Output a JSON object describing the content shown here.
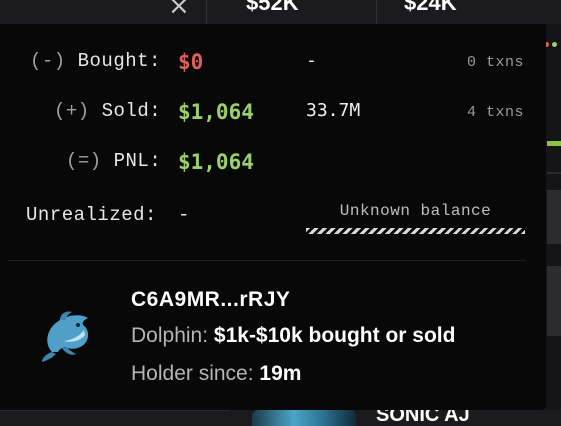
{
  "background": {
    "close_icon": "×",
    "stat_1": "$52K",
    "stat_2": "$24K",
    "token_name": "SONIC AJ",
    "dot_colors": [
      "#e0615c",
      "#9bd06a"
    ],
    "accent_green": "#8ec13f"
  },
  "tooltip": {
    "bought": {
      "symbol": "(-)",
      "label": "Bought:",
      "amount": "$0",
      "quantity": "-",
      "txns": "0 txns"
    },
    "sold": {
      "symbol": "(+)",
      "label": "Sold:",
      "amount": "$1,064",
      "quantity": "33.7M",
      "txns": "4 txns"
    },
    "pnl": {
      "symbol": "(=)",
      "label": "PNL:",
      "amount": "$1,064"
    },
    "unrealized": {
      "label": "Unrealized:",
      "value": "-",
      "balance_text": "Unknown balance"
    },
    "holder": {
      "icon": "dolphin-icon",
      "address": "C6A9MR...rRJY",
      "tier_label": "Dolphin:",
      "tier_value": "$1k-$10k bought or sold",
      "since_label": "Holder since:",
      "since_value": "19m"
    },
    "colors": {
      "negative": "#e0615c",
      "positive": "#9bd06a",
      "background": "#080808"
    }
  }
}
